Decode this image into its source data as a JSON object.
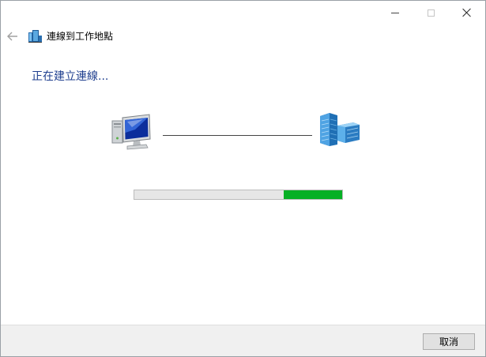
{
  "window": {
    "title": "連線到工作地點",
    "controls": [
      "minimize",
      "maximize",
      "close"
    ]
  },
  "status": {
    "heading": "正在建立連線..."
  },
  "connection": {
    "local_icon": "computer-icon",
    "remote_icon": "workplace-server-icon"
  },
  "progress": {
    "value_start": 0.72,
    "value_end": 1.0,
    "fill_color": "#06b025",
    "track_color": "#e6e6e6"
  },
  "footer": {
    "cancel_label": "取消"
  },
  "colors": {
    "heading": "#1f3f8f",
    "background": "#ffffff",
    "footer": "#f0f0f0"
  }
}
